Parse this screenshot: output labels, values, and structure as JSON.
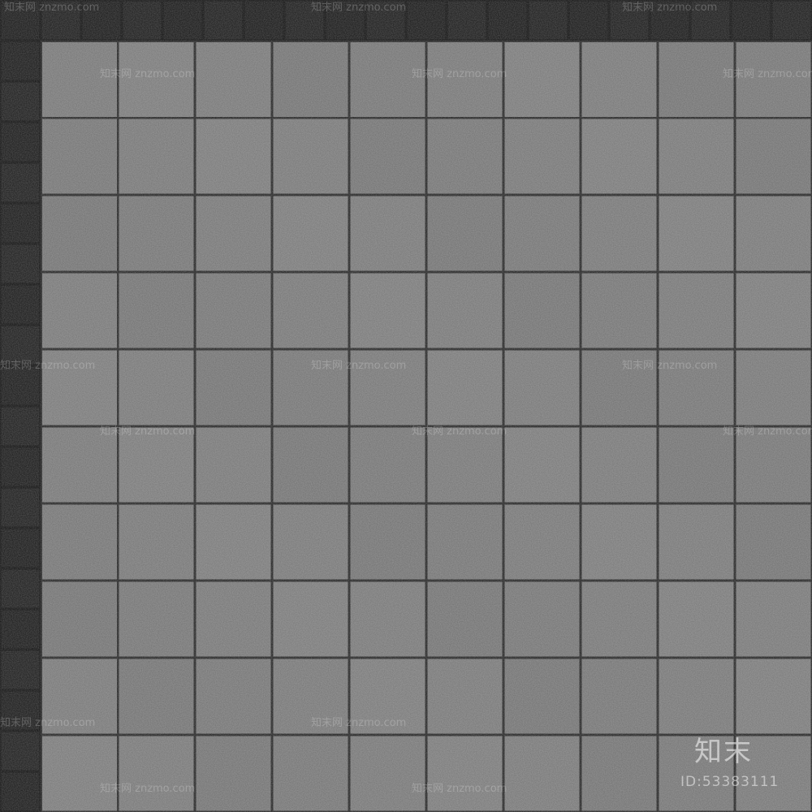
{
  "texture": {
    "border_color": "#1f1f1f",
    "grout_color": "#2e2e2e",
    "tile_color": "#7a7a7a",
    "border_rows": 1,
    "field_columns": 10,
    "field_rows": 10
  },
  "watermark": {
    "text": "知末网 znzmo.com",
    "logo": "知末",
    "id": "ID:53383111"
  }
}
